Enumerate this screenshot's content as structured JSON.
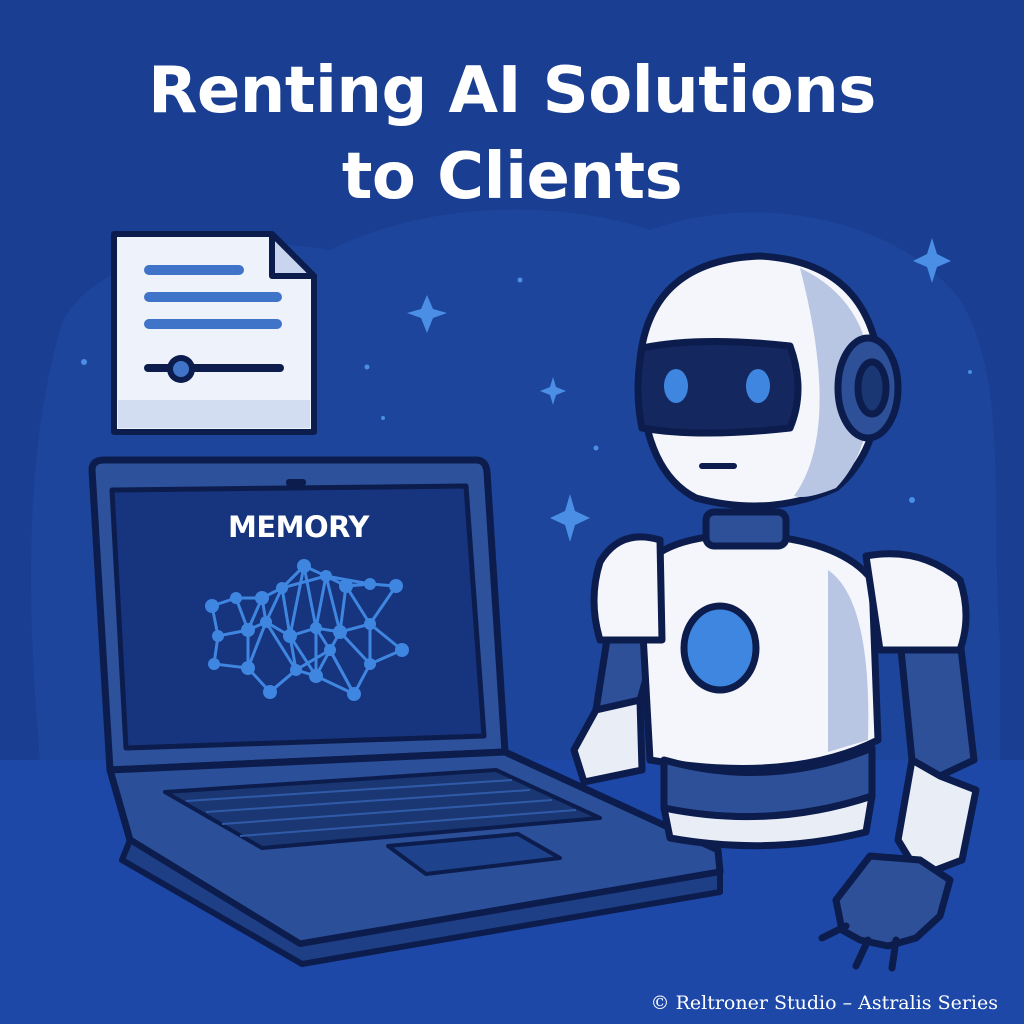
{
  "title": {
    "line1": "Renting AI Solutions",
    "line2": "to Clients"
  },
  "laptop": {
    "screen_label": "MEMORY"
  },
  "credit": "© Reltroner Studio – Astralis Series",
  "icons": [
    "document-icon",
    "slider-icon",
    "laptop-icon",
    "neural-network-icon",
    "robot-icon",
    "sparkle-icon"
  ],
  "colors": {
    "background": "#1a3f92",
    "floor": "#1d48a8",
    "accent": "#3f86e0",
    "outline": "#0c1d4d",
    "robot_white": "#f4f6fb",
    "screen": "#17347f"
  }
}
